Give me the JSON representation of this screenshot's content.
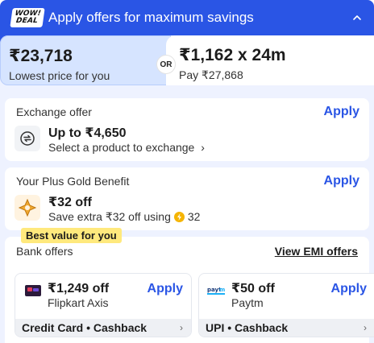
{
  "header": {
    "badge_line1": "WOW!",
    "badge_line2": "DEAL",
    "title": "Apply offers for maximum savings",
    "collapse_icon": "chevron-up-icon"
  },
  "price": {
    "lowest_value": "₹23,718",
    "lowest_label": "Lowest price for you",
    "or_label": "OR",
    "emi_value": "₹1,162 x 24m",
    "emi_sub": "Pay ₹27,868"
  },
  "exchange": {
    "title": "Exchange offer",
    "apply": "Apply",
    "main": "Up to ₹4,650",
    "sub": "Select a product to exchange",
    "sub_arrow": "›",
    "icon": "exchange-icon"
  },
  "plus": {
    "title": "Your Plus Gold Benefit",
    "apply": "Apply",
    "main": "₹32 off",
    "sub_prefix": "Save extra ₹32 off using",
    "coins": "32",
    "icon": "plus-gold-icon"
  },
  "bank": {
    "title": "Bank offers",
    "emi_link": "View EMI offers",
    "best_badge": "Best value for you",
    "cards": [
      {
        "amount": "₹1,249 off",
        "bank": "Flipkart Axis",
        "apply": "Apply",
        "footer": "Credit Card • Cashback",
        "arrow": "›",
        "icon": "axis-card-icon"
      },
      {
        "amount": "₹50 off",
        "bank": "Paytm",
        "apply": "Apply",
        "footer": "UPI • Cashback",
        "arrow": "›",
        "icon": "paytm-icon"
      }
    ]
  },
  "colors": {
    "brand_blue": "#2a55e5",
    "panel_bg": "#eef2ff",
    "badge_yellow": "#ffe97d",
    "gold": "#f5b400"
  }
}
